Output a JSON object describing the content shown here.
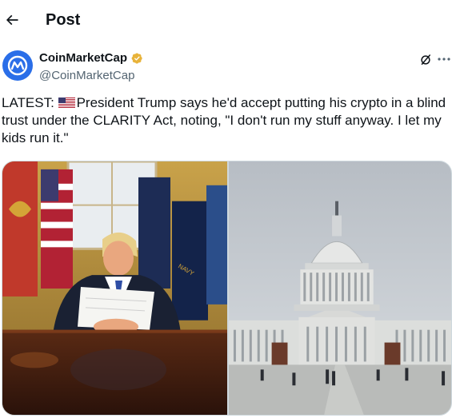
{
  "header": {
    "title": "Post",
    "back_icon": "arrow-left-icon"
  },
  "author": {
    "display_name": "CoinMarketCap",
    "handle": "@CoinMarketCap",
    "verified_badge": "gold-verified-icon",
    "avatar_icon": "coinmarketcap-logo",
    "brand_color": "#2a6ee8"
  },
  "actions": {
    "grok_icon": "grok-icon",
    "more_icon": "more-horizontal-icon"
  },
  "post": {
    "text_prefix": "LATEST:",
    "flag": "us-flag-icon",
    "text_body": "President Trump says he'd accept putting his crypto in a blind trust under the CLARITY Act, noting, \"I don't run my stuff anyway. I let my kids run it.\""
  },
  "media": [
    {
      "name": "photo-trump-oval-office"
    },
    {
      "name": "photo-us-capitol"
    }
  ]
}
